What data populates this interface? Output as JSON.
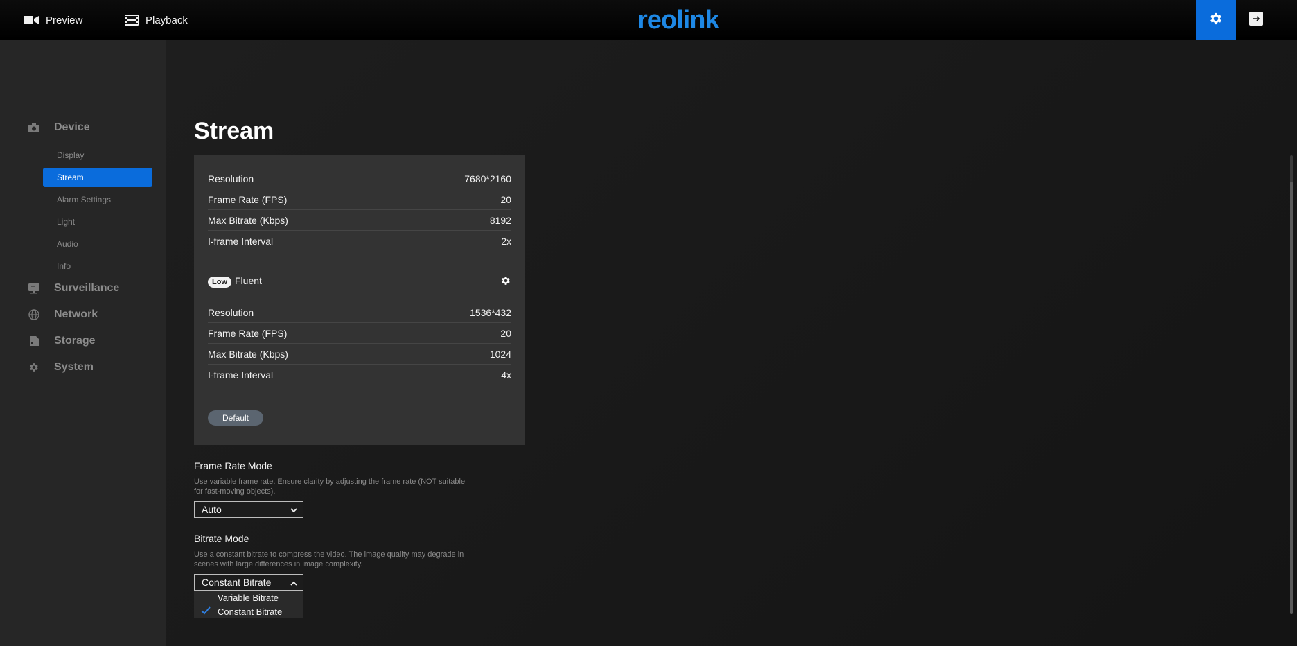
{
  "topbar": {
    "preview_label": "Preview",
    "playback_label": "Playback",
    "logo_text": "reolink",
    "accent_color": "#0a6cdc"
  },
  "sidebar": {
    "groups": [
      {
        "label": "Device",
        "icon": "camera-icon"
      },
      {
        "label": "Surveillance",
        "icon": "monitor-icon"
      },
      {
        "label": "Network",
        "icon": "globe-icon"
      },
      {
        "label": "Storage",
        "icon": "storage-icon"
      },
      {
        "label": "System",
        "icon": "gear-icon"
      }
    ],
    "device_items": [
      {
        "label": "Display"
      },
      {
        "label": "Stream",
        "active": true
      },
      {
        "label": "Alarm Settings"
      },
      {
        "label": "Light"
      },
      {
        "label": "Audio"
      },
      {
        "label": "Info"
      }
    ]
  },
  "page": {
    "title": "Stream"
  },
  "main_stream": {
    "rows": [
      {
        "label": "Resolution",
        "value": "7680*2160"
      },
      {
        "label": "Frame Rate (FPS)",
        "value": "20"
      },
      {
        "label": "Max Bitrate (Kbps)",
        "value": "8192"
      },
      {
        "label": "I-frame Interval",
        "value": "2x"
      }
    ]
  },
  "fluent_stream": {
    "badge": "Low",
    "name": "Fluent",
    "rows": [
      {
        "label": "Resolution",
        "value": "1536*432"
      },
      {
        "label": "Frame Rate (FPS)",
        "value": "20"
      },
      {
        "label": "Max Bitrate (Kbps)",
        "value": "1024"
      },
      {
        "label": "I-frame Interval",
        "value": "4x"
      }
    ]
  },
  "default_button": "Default",
  "frame_rate_mode": {
    "title": "Frame Rate Mode",
    "description": "Use variable frame rate. Ensure clarity by adjusting the frame rate (NOT suitable for fast-moving objects).",
    "value": "Auto"
  },
  "bitrate_mode": {
    "title": "Bitrate Mode",
    "description": "Use a constant bitrate to compress the video. The image quality may degrade in scenes with large differences in image complexity.",
    "value": "Constant Bitrate",
    "options": [
      {
        "label": "Variable Bitrate",
        "selected": false
      },
      {
        "label": "Constant Bitrate",
        "selected": true
      }
    ]
  }
}
